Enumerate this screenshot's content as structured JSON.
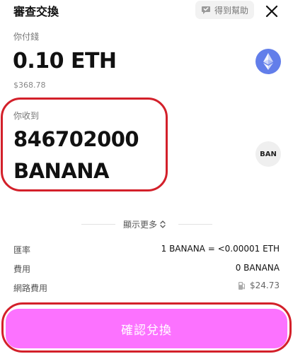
{
  "header": {
    "title": "審查交換",
    "help_label": "得到幫助",
    "help_icon": "chat-help-icon",
    "close_icon": "close-icon"
  },
  "pay": {
    "label": "你付錢",
    "amount": "0.10 ETH",
    "fiat": "$368.78",
    "token_icon": "ethereum-icon",
    "token_color": "#627eea"
  },
  "receive": {
    "label": "你收到",
    "amount": "846702000",
    "token": "BANANA",
    "token_badge": "BAN"
  },
  "show_more": {
    "label": "顯示更多",
    "icon": "chevron-updown-icon"
  },
  "details": {
    "rate_label": "匯率",
    "rate_value": "1 BANANA = <0.00001 ETH",
    "fee_label": "費用",
    "fee_value": "0 BANANA",
    "network_fee_label": "網路費用",
    "network_fee_value": "$24.73",
    "network_fee_icon": "gas-pump-icon"
  },
  "confirm": {
    "label": "確認兌換",
    "color": "#fc72ff"
  },
  "annotation": {
    "highlight_color": "#d3202a"
  }
}
